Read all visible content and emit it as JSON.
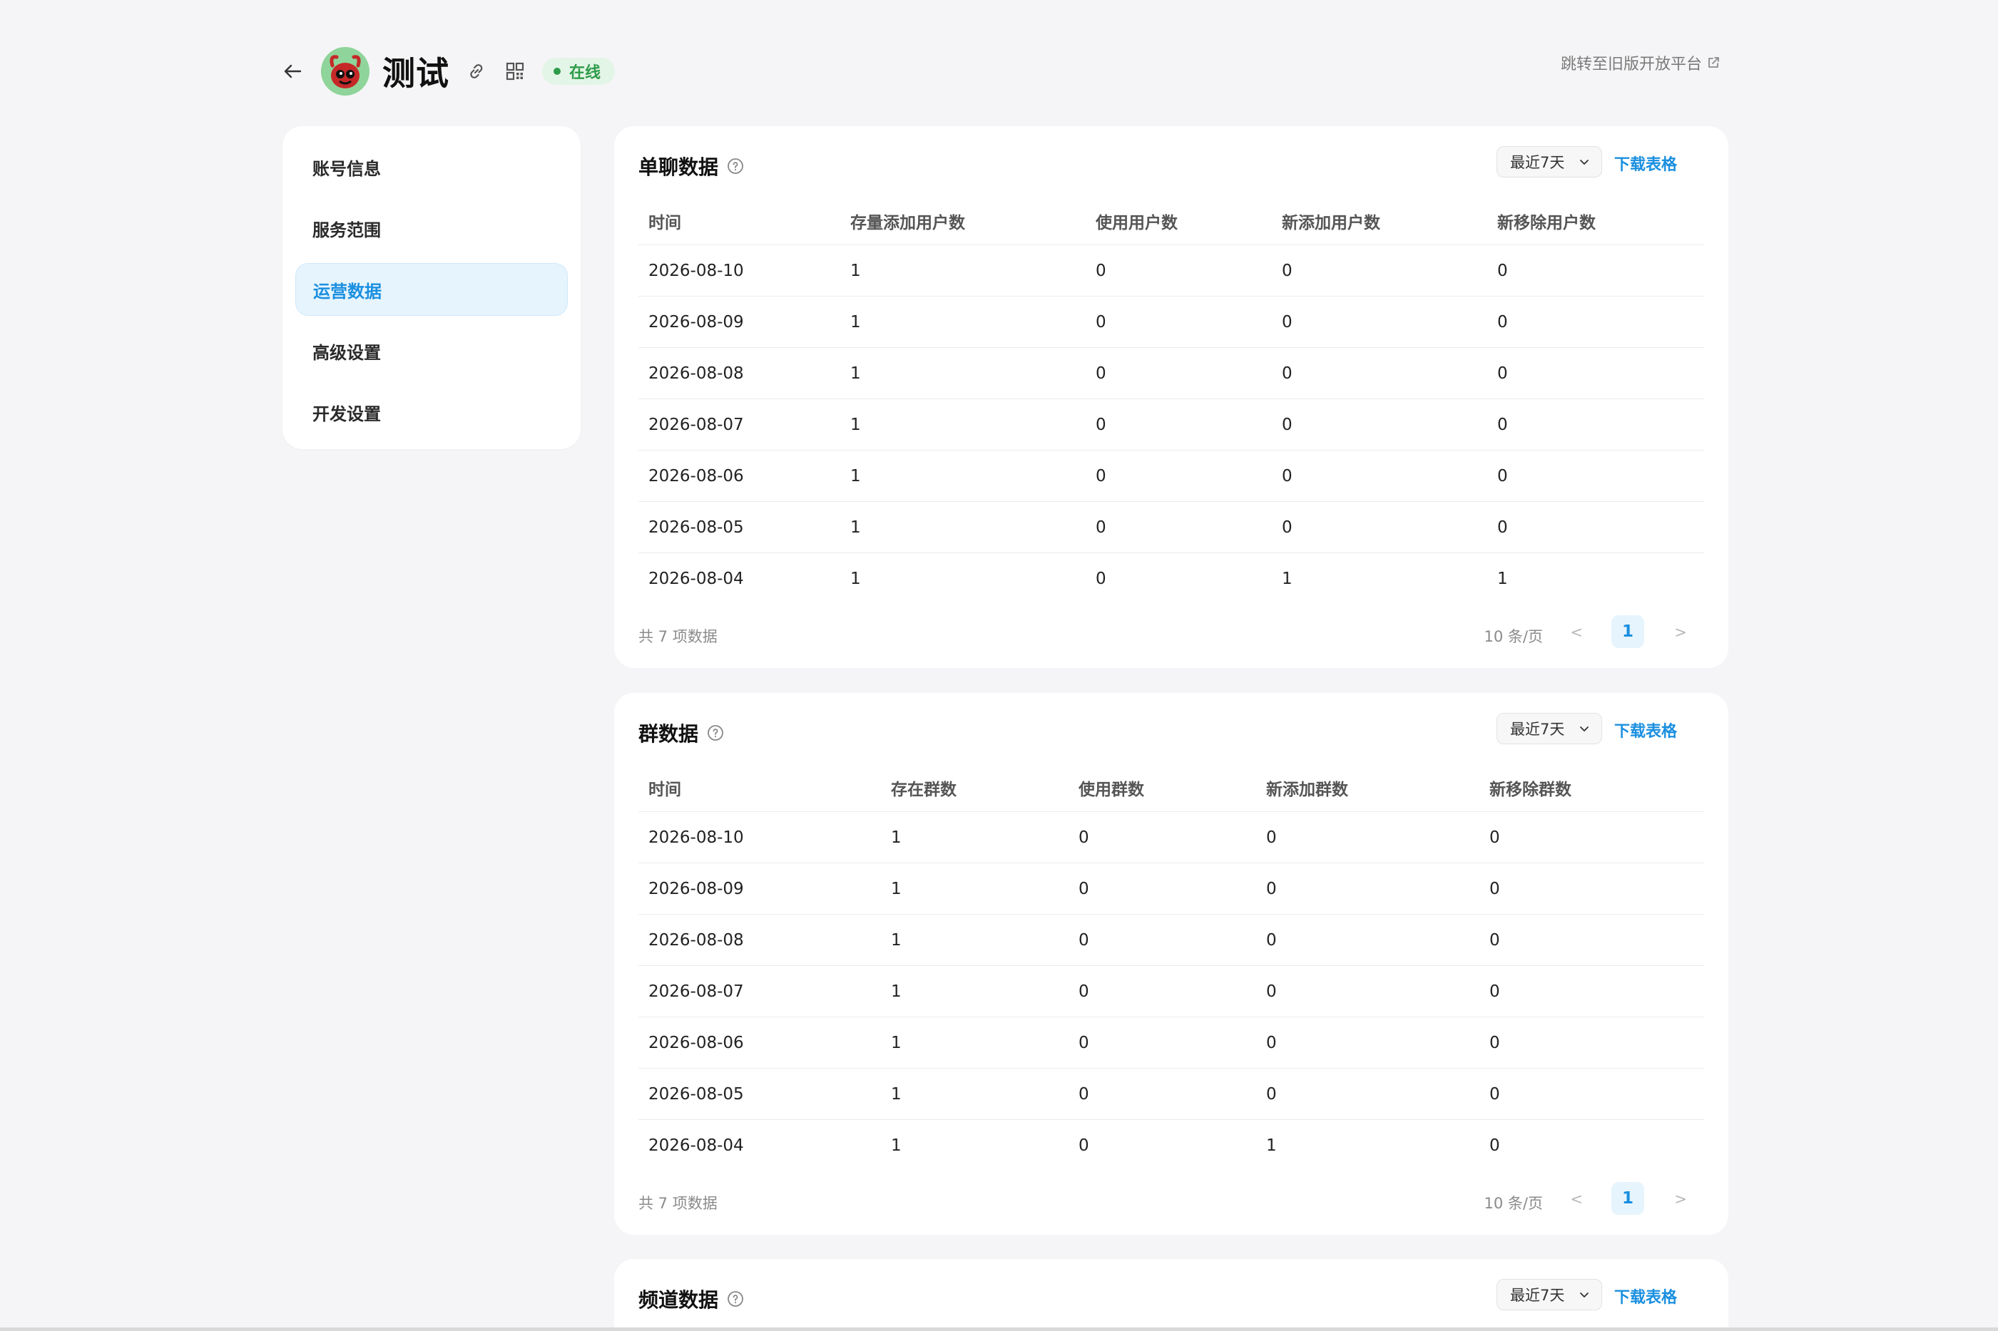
{
  "header": {
    "app_name": "测试",
    "status": "在线",
    "old_platform_link": "跳转至旧版开放平台"
  },
  "sidebar": {
    "items": [
      {
        "label": "账号信息",
        "active": false
      },
      {
        "label": "服务范围",
        "active": false
      },
      {
        "label": "运营数据",
        "active": true
      },
      {
        "label": "高级设置",
        "active": false
      },
      {
        "label": "开发设置",
        "active": false
      }
    ]
  },
  "colors": {
    "accent": "#1a8fe0",
    "status_green": "#2e9b4a",
    "page_bg": "#f5f5f7"
  },
  "single_chat": {
    "title": "单聊数据",
    "range": "最近7天",
    "download": "下载表格",
    "columns": [
      "时间",
      "存量添加用户数",
      "使用用户数",
      "新添加用户数",
      "新移除用户数"
    ],
    "rows": [
      [
        "2026-08-10",
        "1",
        "0",
        "0",
        "0"
      ],
      [
        "2026-08-09",
        "1",
        "0",
        "0",
        "0"
      ],
      [
        "2026-08-08",
        "1",
        "0",
        "0",
        "0"
      ],
      [
        "2026-08-07",
        "1",
        "0",
        "0",
        "0"
      ],
      [
        "2026-08-06",
        "1",
        "0",
        "0",
        "0"
      ],
      [
        "2026-08-05",
        "1",
        "0",
        "0",
        "0"
      ],
      [
        "2026-08-04",
        "1",
        "0",
        "1",
        "1"
      ]
    ],
    "total": "共 7 项数据",
    "page_size": "10 条/页",
    "current_page": "1",
    "prev": "<",
    "next": ">"
  },
  "group": {
    "title": "群数据",
    "range": "最近7天",
    "download": "下载表格",
    "columns": [
      "时间",
      "存在群数",
      "使用群数",
      "新添加群数",
      "新移除群数"
    ],
    "rows": [
      [
        "2026-08-10",
        "1",
        "0",
        "0",
        "0"
      ],
      [
        "2026-08-09",
        "1",
        "0",
        "0",
        "0"
      ],
      [
        "2026-08-08",
        "1",
        "0",
        "0",
        "0"
      ],
      [
        "2026-08-07",
        "1",
        "0",
        "0",
        "0"
      ],
      [
        "2026-08-06",
        "1",
        "0",
        "0",
        "0"
      ],
      [
        "2026-08-05",
        "1",
        "0",
        "0",
        "0"
      ],
      [
        "2026-08-04",
        "1",
        "0",
        "1",
        "0"
      ]
    ],
    "total": "共 7 项数据",
    "page_size": "10 条/页",
    "current_page": "1",
    "prev": "<",
    "next": ">"
  },
  "channel": {
    "title": "频道数据",
    "range": "最近7天",
    "download": "下载表格"
  }
}
